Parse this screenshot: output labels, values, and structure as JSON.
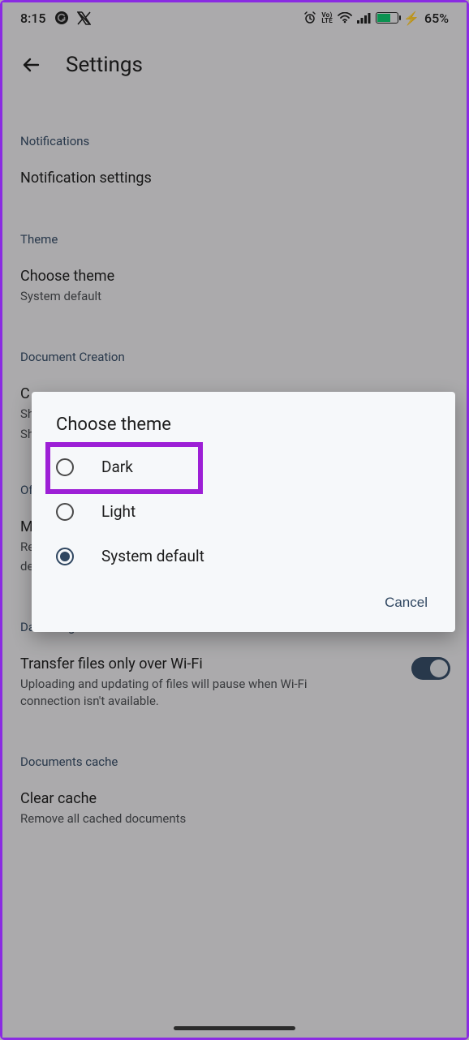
{
  "status": {
    "time": "8:15",
    "battery_pct": "65%"
  },
  "header": {
    "title": "Settings"
  },
  "sections": {
    "notifications": {
      "header": "Notifications",
      "row1": "Notification settings"
    },
    "theme": {
      "header": "Theme",
      "row1": "Choose theme",
      "row1_sub": "System default"
    },
    "doc_creation": {
      "header": "Document Creation",
      "row1": "C",
      "row1_sub": "Sh",
      "row1_sub2": "Sh"
    },
    "offline": {
      "header": "Of",
      "row1": "M",
      "row1_sub": "Re",
      "row1_sub2": "de"
    },
    "data_usage": {
      "header": "Data usage",
      "row1": "Transfer files only over Wi-Fi",
      "row1_sub": "Uploading and updating of files will pause when Wi-Fi connection isn't available."
    },
    "cache": {
      "header": "Documents cache",
      "row1": "Clear cache",
      "row1_sub": "Remove all cached documents"
    }
  },
  "dialog": {
    "title": "Choose theme",
    "options": [
      "Dark",
      "Light",
      "System default"
    ],
    "selected_index": 2,
    "cancel": "Cancel"
  }
}
